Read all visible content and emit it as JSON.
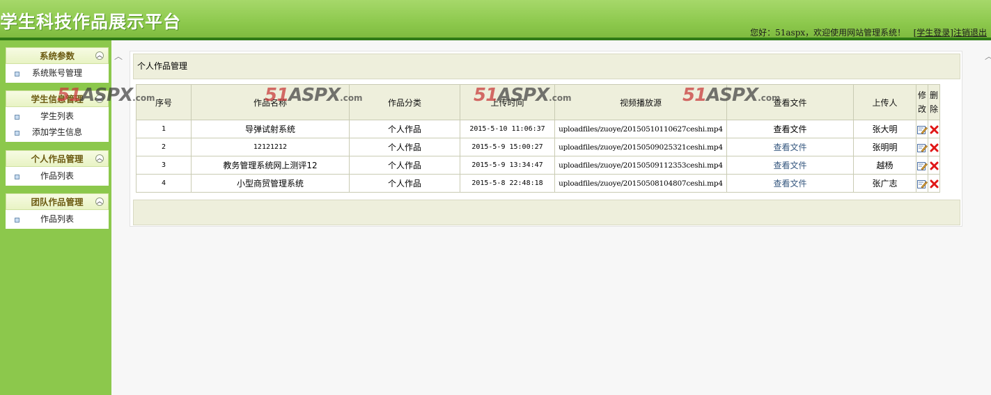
{
  "header": {
    "title": "学生科技作品展示平台",
    "welcome_text": "您好：51aspx，欢迎使用网站管理系统！",
    "login_link": "[学生登录]",
    "logout_link": "注销退出"
  },
  "sidebar": {
    "panels": [
      {
        "title": "系统参数",
        "toggle_icon": "collapse-icon",
        "items": [
          {
            "label": "系统账号管理"
          }
        ]
      },
      {
        "title": "学生信息管理",
        "toggle_icon": "collapse-icon",
        "items": [
          {
            "label": "学生列表"
          },
          {
            "label": "添加学生信息"
          }
        ]
      },
      {
        "title": "个人作品管理",
        "toggle_icon": "collapse-icon",
        "items": [
          {
            "label": "作品列表"
          }
        ]
      },
      {
        "title": "团队作品管理",
        "toggle_icon": "collapse-icon",
        "items": [
          {
            "label": "作品列表"
          }
        ]
      }
    ]
  },
  "main": {
    "section_title": "个人作品管理",
    "table": {
      "headers": [
        "序号",
        "作品名称",
        "作品分类",
        "上传时间",
        "视频播放源",
        "查看文件",
        "上传人",
        "修改",
        "删除"
      ],
      "rows": [
        {
          "no": "1",
          "name": "导弹试射系统",
          "category": "个人作品",
          "time": "2015-5-10 11:06:37",
          "video": "uploadfiles/zuoye/20150510110627ceshi.mp4",
          "view": "查看文件",
          "uploader": "张大明"
        },
        {
          "no": "2",
          "name": "12121212",
          "category": "个人作品",
          "time": "2015-5-9 15:00:27",
          "video": "uploadfiles/zuoye/20150509025321ceshi.mp4",
          "view": "查看文件",
          "uploader": "张明明"
        },
        {
          "no": "3",
          "name": "教务管理系统网上测评12",
          "category": "个人作品",
          "time": "2015-5-9 13:34:47",
          "video": "uploadfiles/zuoye/20150509112353ceshi.mp4",
          "view": "查看文件",
          "uploader": "越杨"
        },
        {
          "no": "4",
          "name": "小型商贸管理系统",
          "category": "个人作品",
          "time": "2015-5-8 22:48:18",
          "video": "uploadfiles/zuoye/20150508104807ceshi.mp4",
          "view": "查看文件",
          "uploader": "张广志"
        }
      ]
    }
  },
  "watermark": {
    "main": "51",
    "accent": "ASPX",
    "suffix": ".com"
  },
  "colors": {
    "header_green": "#8cc84c",
    "header_line": "#2f7a16",
    "sidebar_green": "#8cc84c",
    "panel_title": "#6b5a11",
    "section_bg": "#eeefdc",
    "link": "#35577f"
  }
}
